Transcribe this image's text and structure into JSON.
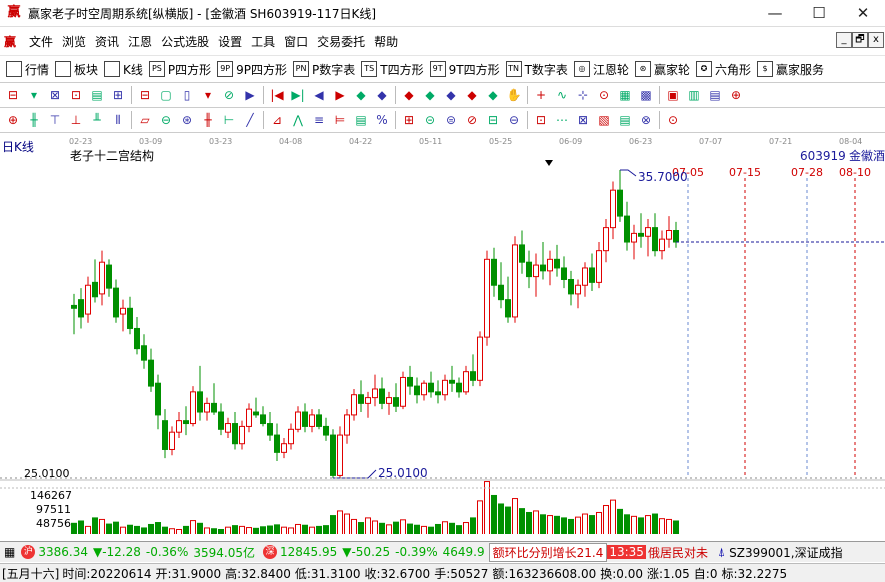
{
  "window": {
    "title": "赢家老子时空周期系统[纵横版] - [金徽酒  SH603919-117日K线]",
    "minimize": "—",
    "maximize": "☐",
    "close": "✕"
  },
  "menu": {
    "logo": "赢",
    "items": [
      "文件",
      "浏览",
      "资讯",
      "江恩",
      "公式选股",
      "设置",
      "工具",
      "窗口",
      "交易委托",
      "帮助"
    ],
    "mdi": [
      "_",
      "🗗",
      "x"
    ]
  },
  "toolbar1": [
    {
      "label": "行情",
      "icon": "grid-icon"
    },
    {
      "label": "板块",
      "icon": "blocks-icon"
    },
    {
      "label": "K线",
      "icon": "candles-icon"
    },
    {
      "label": "P四方形",
      "icon": "ps-icon",
      "icon_text": "PS"
    },
    {
      "label": "9P四方形",
      "icon": "9p-icon",
      "icon_text": "9P"
    },
    {
      "label": "P数字表",
      "icon": "pn-icon",
      "icon_text": "PN"
    },
    {
      "label": "T四方形",
      "icon": "ts-icon",
      "icon_text": "TS"
    },
    {
      "label": "9T四方形",
      "icon": "9t-icon",
      "icon_text": "9T"
    },
    {
      "label": "T数字表",
      "icon": "tn-icon",
      "icon_text": "TN"
    },
    {
      "label": "江恩轮",
      "icon": "wheel-icon",
      "icon_text": "◎"
    },
    {
      "label": "赢家轮",
      "icon": "winner-wheel-icon",
      "icon_text": "⊛"
    },
    {
      "label": "六角形",
      "icon": "hexagon-icon",
      "icon_text": "✪"
    },
    {
      "label": "赢家服务",
      "icon": "dollar-icon",
      "icon_text": "$"
    }
  ],
  "toolbar2": [
    "⊟",
    "▾",
    "⊠",
    "⊡",
    "▤",
    "⊞",
    "⊟",
    "▢",
    "▯",
    "▾",
    "⊘",
    "▶",
    "|◀",
    "▶|",
    "◀",
    "▶",
    "◆",
    "◆",
    "◆",
    "◆",
    "◆",
    "◆",
    "◆",
    "✋",
    "+",
    "∿",
    "⊹",
    "⊙",
    "▦",
    "▩",
    "▣",
    "▥",
    "▤",
    "⊕"
  ],
  "toolbar3": [
    "⊕",
    "╫",
    "⊤",
    "⊥",
    "╨",
    "⫴",
    "▱",
    "⊖",
    "⊛",
    "╫",
    "⊢",
    "╱",
    "⊿",
    "⋀",
    "≡",
    "⊨",
    "▤",
    "%",
    "⊞",
    "⊝",
    "⊜",
    "⊘",
    "⊟",
    "⊖",
    "⊡",
    "⋯",
    "⊠",
    "▧",
    "▤",
    "⊗",
    "⊙"
  ],
  "chart": {
    "period_label": "日K线",
    "indicator_name": "老子十二宫结构",
    "stock_code": "603919",
    "stock_name": "金徽酒",
    "high_marker": "35.7000",
    "low_marker": "25.0100",
    "price_axis_label": "25.0100",
    "volume_ticks": [
      "146267",
      "97511",
      "48756"
    ],
    "top_dates": [
      "02-23",
      "03-09",
      "03-23",
      "04-08",
      "04-22",
      "05-11",
      "05-25",
      "06-09",
      "06-23",
      "07-07",
      "07-21",
      "08-04"
    ],
    "projected_dates": [
      "07-05",
      "07-15",
      "07-28",
      "08-10"
    ],
    "colors": {
      "up": "#e00000",
      "down": "#009000",
      "projection": "#d00000",
      "marker": "#1a1a9a"
    }
  },
  "chart_data": {
    "type": "candlestick",
    "title": "老子十二宫结构",
    "high": 35.7,
    "low": 25.01,
    "candles": [
      [
        31.0,
        31.4,
        30.0,
        30.9
      ],
      [
        31.2,
        31.6,
        30.2,
        30.6
      ],
      [
        30.7,
        32.0,
        30.4,
        31.7
      ],
      [
        31.8,
        32.6,
        31.1,
        31.3
      ],
      [
        31.4,
        32.9,
        31.0,
        32.5
      ],
      [
        32.4,
        32.6,
        31.3,
        31.6
      ],
      [
        31.6,
        31.9,
        30.4,
        30.6
      ],
      [
        30.7,
        31.2,
        30.1,
        30.9
      ],
      [
        30.9,
        31.3,
        30.0,
        30.2
      ],
      [
        30.2,
        30.6,
        29.3,
        29.5
      ],
      [
        29.6,
        30.0,
        28.8,
        29.1
      ],
      [
        29.1,
        29.5,
        28.0,
        28.2
      ],
      [
        28.3,
        28.6,
        26.7,
        27.2
      ],
      [
        27.0,
        27.4,
        25.7,
        26.0
      ],
      [
        26.0,
        26.8,
        25.8,
        26.6
      ],
      [
        26.6,
        27.3,
        26.4,
        27.0
      ],
      [
        27.0,
        27.5,
        26.5,
        26.9
      ],
      [
        26.9,
        28.2,
        26.8,
        28.0
      ],
      [
        28.0,
        28.9,
        27.0,
        27.3
      ],
      [
        27.3,
        27.8,
        27.0,
        27.6
      ],
      [
        27.6,
        28.3,
        27.2,
        27.3
      ],
      [
        27.3,
        27.6,
        26.5,
        26.7
      ],
      [
        26.6,
        27.1,
        26.4,
        26.9
      ],
      [
        26.9,
        27.3,
        26.0,
        26.2
      ],
      [
        26.2,
        27.0,
        26.0,
        26.8
      ],
      [
        26.8,
        27.6,
        26.6,
        27.4
      ],
      [
        27.3,
        27.8,
        27.1,
        27.2
      ],
      [
        27.2,
        27.5,
        26.8,
        26.9
      ],
      [
        26.9,
        27.3,
        26.3,
        26.5
      ],
      [
        26.5,
        26.9,
        25.6,
        25.9
      ],
      [
        25.9,
        26.4,
        25.7,
        26.2
      ],
      [
        26.2,
        26.9,
        26.0,
        26.7
      ],
      [
        26.7,
        27.5,
        26.6,
        27.3
      ],
      [
        27.3,
        27.6,
        26.6,
        26.8
      ],
      [
        26.8,
        27.4,
        26.6,
        27.2
      ],
      [
        27.2,
        27.4,
        26.7,
        26.8
      ],
      [
        26.8,
        27.1,
        26.3,
        26.5
      ],
      [
        26.5,
        26.7,
        25.0,
        25.1
      ],
      [
        25.1,
        26.8,
        25.0,
        26.5
      ],
      [
        26.5,
        27.4,
        26.2,
        27.2
      ],
      [
        27.2,
        28.1,
        27.0,
        27.9
      ],
      [
        27.9,
        28.4,
        27.3,
        27.6
      ],
      [
        27.6,
        28.0,
        27.1,
        27.8
      ],
      [
        27.8,
        28.6,
        27.5,
        28.1
      ],
      [
        28.1,
        28.5,
        27.4,
        27.6
      ],
      [
        27.6,
        28.0,
        27.2,
        27.8
      ],
      [
        27.8,
        28.3,
        27.3,
        27.5
      ],
      [
        27.5,
        28.7,
        27.4,
        28.5
      ],
      [
        28.5,
        28.9,
        27.9,
        28.2
      ],
      [
        28.2,
        28.5,
        27.6,
        27.9
      ],
      [
        27.9,
        28.4,
        27.7,
        28.3
      ],
      [
        28.3,
        28.7,
        27.8,
        28.0
      ],
      [
        28.0,
        28.4,
        27.6,
        27.9
      ],
      [
        27.9,
        28.6,
        27.7,
        28.4
      ],
      [
        28.4,
        28.9,
        28.0,
        28.3
      ],
      [
        28.3,
        28.5,
        27.8,
        28.0
      ],
      [
        28.0,
        28.9,
        27.9,
        28.7
      ],
      [
        28.7,
        29.3,
        28.2,
        28.4
      ],
      [
        28.4,
        30.1,
        28.2,
        29.9
      ],
      [
        29.9,
        32.9,
        29.6,
        32.6
      ],
      [
        32.6,
        33.0,
        31.3,
        31.7
      ],
      [
        31.7,
        32.5,
        30.9,
        31.2
      ],
      [
        31.2,
        32.0,
        30.4,
        30.6
      ],
      [
        30.6,
        33.4,
        30.4,
        33.1
      ],
      [
        33.1,
        33.6,
        32.1,
        32.5
      ],
      [
        32.5,
        32.9,
        31.6,
        32.0
      ],
      [
        32.0,
        32.8,
        31.3,
        32.4
      ],
      [
        32.4,
        33.2,
        31.9,
        32.2
      ],
      [
        32.2,
        32.9,
        31.7,
        32.6
      ],
      [
        32.6,
        33.1,
        32.0,
        32.3
      ],
      [
        32.3,
        32.7,
        31.6,
        31.9
      ],
      [
        31.9,
        32.2,
        31.0,
        31.4
      ],
      [
        31.4,
        31.9,
        30.9,
        31.7
      ],
      [
        31.7,
        32.5,
        31.3,
        32.3
      ],
      [
        32.3,
        32.8,
        31.5,
        31.8
      ],
      [
        31.8,
        33.2,
        31.6,
        32.9
      ],
      [
        32.9,
        34.0,
        32.5,
        33.7
      ],
      [
        33.7,
        35.3,
        33.3,
        35.0
      ],
      [
        35.0,
        35.7,
        33.9,
        34.1
      ],
      [
        34.1,
        34.6,
        32.9,
        33.2
      ],
      [
        33.2,
        33.8,
        32.6,
        33.5
      ],
      [
        33.5,
        34.2,
        33.0,
        33.4
      ],
      [
        33.4,
        34.0,
        32.7,
        33.7
      ],
      [
        33.7,
        34.2,
        32.7,
        32.9
      ],
      [
        32.9,
        33.6,
        32.6,
        33.3
      ],
      [
        33.3,
        34.1,
        33.0,
        33.6
      ],
      [
        33.6,
        33.9,
        33.0,
        33.2
      ]
    ],
    "volumes": [
      38,
      44,
      30,
      52,
      48,
      36,
      41,
      28,
      33,
      30,
      26,
      35,
      40,
      28,
      24,
      22,
      30,
      45,
      38,
      26,
      24,
      22,
      28,
      32,
      30,
      27,
      25,
      29,
      31,
      34,
      28,
      26,
      35,
      33,
      28,
      30,
      32,
      58,
      70,
      62,
      48,
      40,
      52,
      44,
      38,
      34,
      41,
      47,
      36,
      33,
      30,
      28,
      35,
      42,
      38,
      32,
      40,
      52,
      96,
      146,
      110,
      88,
      80,
      102,
      76,
      66,
      70,
      60,
      58,
      56,
      52,
      48,
      54,
      62,
      58,
      66,
      84,
      98,
      74,
      60,
      56,
      52,
      58,
      62,
      50,
      48,
      44
    ],
    "volume_ticks": [
      146267,
      97511,
      48756
    ],
    "ylim": [
      25.01,
      35.7
    ]
  },
  "status": {
    "sh_index": "3386.34",
    "sh_change": "▼-12.28",
    "sh_pct": "-0.36%",
    "sh_amount": "3594.05亿",
    "sz_index": "12845.95",
    "sz_change": "▼-50.25",
    "sz_pct": "-0.39%",
    "sz_amount": "4649.9",
    "news": "额环比分别增长21.4",
    "time": "13:35",
    "news2": "俄居民对未",
    "sz_code": "SZ399001,深证成指",
    "index_icon": "沪",
    "index_icon2": "深"
  },
  "info": {
    "lunar": "[五月十六]",
    "time": "时间:20220614",
    "open": "开:31.9000",
    "high": "高:32.8400",
    "low": "低:31.3100",
    "close": "收:32.6700",
    "hand": "手:50527",
    "amount": "额:163236608.00",
    "turnover": "换:0.00",
    "change": "涨:1.05",
    "pos": "自:0",
    "target": "标:32.2275"
  }
}
